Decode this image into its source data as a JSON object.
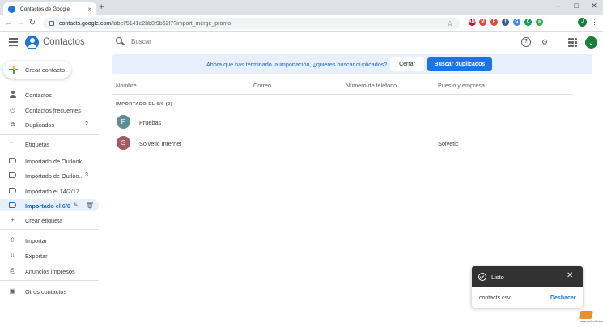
{
  "browser": {
    "tab_title": "Contactos de Google",
    "tab_close": "×",
    "new_tab": "+",
    "url_host": "contacts.google.com",
    "url_path": "/label/5141e2bb8f9b62f7?import_merge_promo",
    "extensions": [
      {
        "label": "ABP",
        "color": "#c70d2c"
      },
      {
        "label": "M",
        "color": "#db4437"
      },
      {
        "label": "P",
        "color": "#e8453c"
      },
      {
        "label": "f",
        "color": "#3b5998"
      },
      {
        "label": "G",
        "color": "#4285f4"
      },
      {
        "label": "C",
        "color": "#0f9d58"
      },
      {
        "label": "a",
        "color": "#34a853"
      }
    ],
    "profile_initial": "J"
  },
  "app": {
    "title": "Contactos",
    "search_placeholder": "Buscar",
    "avatar_initial": "J"
  },
  "sidebar": {
    "create_label": "Crear contacto",
    "items": [
      {
        "label": "Contactos",
        "count": ""
      },
      {
        "label": "Contactos frecuentes",
        "count": ""
      },
      {
        "label": "Duplicados",
        "count": "2"
      }
    ],
    "labels_section": "Etiquetas",
    "labels": [
      {
        "label": "Importado de Outlook...",
        "count": ""
      },
      {
        "label": "Importado de Outloo...",
        "count": "3"
      },
      {
        "label": "Importado el 14/2/17",
        "count": ""
      },
      {
        "label": "Importado el 6/6",
        "count": ""
      }
    ],
    "create_label_item": "Crear etiqueta",
    "actions": [
      {
        "label": "Importar"
      },
      {
        "label": "Exportar"
      },
      {
        "label": "Anuncios impresos"
      }
    ],
    "other_contacts": "Otros contactos"
  },
  "banner": {
    "text": "Ahora que has terminado la importación, ¿quieres buscar duplicados?",
    "close_label": "Cerrar",
    "find_label": "Buscar duplicados"
  },
  "table": {
    "columns": [
      "Nombre",
      "Correo",
      "Número de teléfono",
      "Puesto y empresa"
    ],
    "group_header": "IMPORTADO EL 6/6 (2)",
    "rows": [
      {
        "initial": "P",
        "name": "Pruebas",
        "company": "",
        "color": "#5f8d96"
      },
      {
        "initial": "S",
        "name": "Solvetic Internet",
        "company": "Solvetic",
        "color": "#a65a5e"
      }
    ]
  },
  "snackbar": {
    "title": "Listo",
    "file": "contacts.csv",
    "undo": "Deshacer"
  },
  "watermark": {
    "text": "www.solvetic.com"
  }
}
